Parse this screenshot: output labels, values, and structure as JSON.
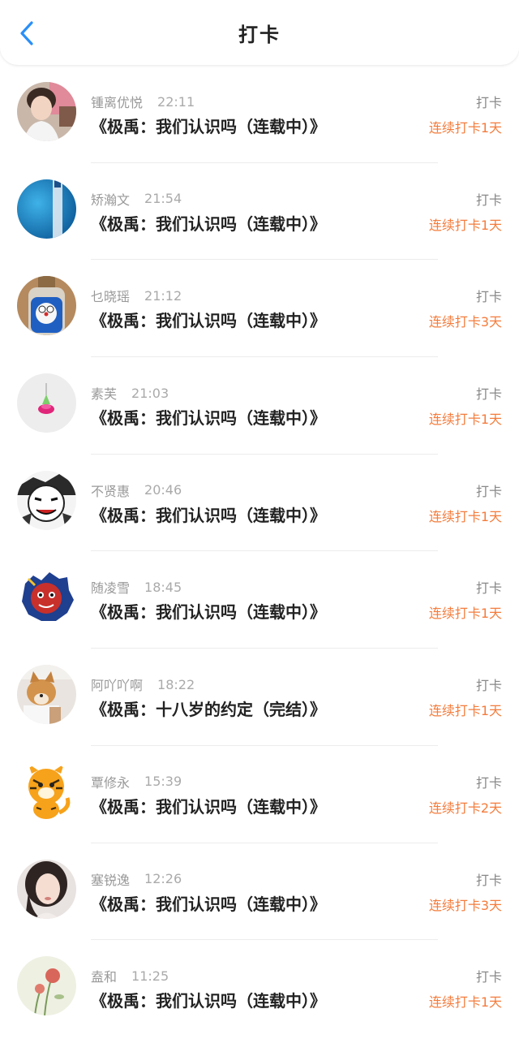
{
  "header": {
    "title": "打卡",
    "accent_color": "#2a8ff7"
  },
  "colors": {
    "streak": "#f47c3c",
    "meta": "#999999",
    "title": "#222222"
  },
  "entries": [
    {
      "name": "锺离优悦",
      "time": "22:11",
      "book": "《极禹：我们认识吗（连载中）》",
      "checkin_label": "打卡",
      "streak": "连续打卡1天",
      "avatar_icon": "boy-photo"
    },
    {
      "name": "矫瀚文",
      "time": "21:54",
      "book": "《极禹：我们认识吗（连载中）》",
      "checkin_label": "打卡",
      "streak": "连续打卡1天",
      "avatar_icon": "blue-bottle-photo"
    },
    {
      "name": "乜晓瑶",
      "time": "21:12",
      "book": "《极禹：我们认识吗（连载中）》",
      "checkin_label": "打卡",
      "streak": "连续打卡3天",
      "avatar_icon": "doraemon-jar-photo"
    },
    {
      "name": "素芙",
      "time": "21:03",
      "book": "《极禹：我们认识吗（连载中）》",
      "checkin_label": "打卡",
      "streak": "连续打卡1天",
      "avatar_icon": "pink-flower-photo"
    },
    {
      "name": "不贤惠",
      "time": "20:46",
      "book": "《极禹：我们认识吗（连载中）》",
      "checkin_label": "打卡",
      "streak": "连续打卡1天",
      "avatar_icon": "manga-face-drawing"
    },
    {
      "name": "随凌雪",
      "time": "18:45",
      "book": "《极禹：我们认识吗（连载中）》",
      "checkin_label": "打卡",
      "streak": "连续打卡1天",
      "avatar_icon": "red-lion-sticker"
    },
    {
      "name": "阿吖吖啊",
      "time": "18:22",
      "book": "《极禹：十八岁的约定（完结）》",
      "checkin_label": "打卡",
      "streak": "连续打卡1天",
      "avatar_icon": "shiba-dog-photo"
    },
    {
      "name": "覃修永",
      "time": "15:39",
      "book": "《极禹：我们认识吗（连载中）》",
      "checkin_label": "打卡",
      "streak": "连续打卡2天",
      "avatar_icon": "cartoon-tiger"
    },
    {
      "name": "塞锐逸",
      "time": "12:26",
      "book": "《极禹：我们认识吗（连载中）》",
      "checkin_label": "打卡",
      "streak": "连续打卡3天",
      "avatar_icon": "girl-portrait-photo"
    },
    {
      "name": "盍和",
      "time": "11:25",
      "book": "《极禹：我们认识吗（连载中）》",
      "checkin_label": "打卡",
      "streak": "连续打卡1天",
      "avatar_icon": "poppy-flower-photo"
    }
  ]
}
